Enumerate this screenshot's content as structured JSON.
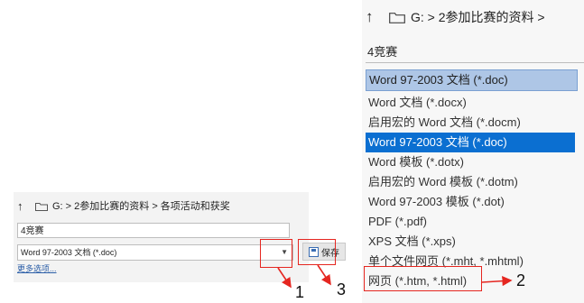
{
  "left_dialog": {
    "path": "G: > 2参加比赛的资料 > 各项活动和获奖",
    "filename": "4竞赛",
    "file_type": "Word 97-2003 文档 (*.doc)",
    "more_options": "更多选项...",
    "save_label": "保存"
  },
  "right_dialog": {
    "path": "G: > 2参加比赛的资料 >",
    "filename": "4竞赛",
    "selected_type": "Word 97-2003 文档 (*.doc)",
    "types": [
      "Word 文档 (*.docx)",
      "启用宏的 Word 文档 (*.docm)",
      "Word 97-2003 文档 (*.doc)",
      "Word 模板 (*.dotx)",
      "启用宏的 Word 模板 (*.dotm)",
      "Word 97-2003 模板 (*.dot)",
      "PDF (*.pdf)",
      "XPS 文档 (*.xps)",
      "单个文件网页 (*.mht, *.mhtml)",
      "网页 (*.htm, *.html)"
    ],
    "highlighted_index": 2
  },
  "annotations": {
    "label_1": "1",
    "label_2": "2",
    "label_3": "3"
  },
  "colors": {
    "annotation_red": "#e52620",
    "highlight_blue": "#0b6fd1",
    "selected_bg": "#aec6e6"
  }
}
